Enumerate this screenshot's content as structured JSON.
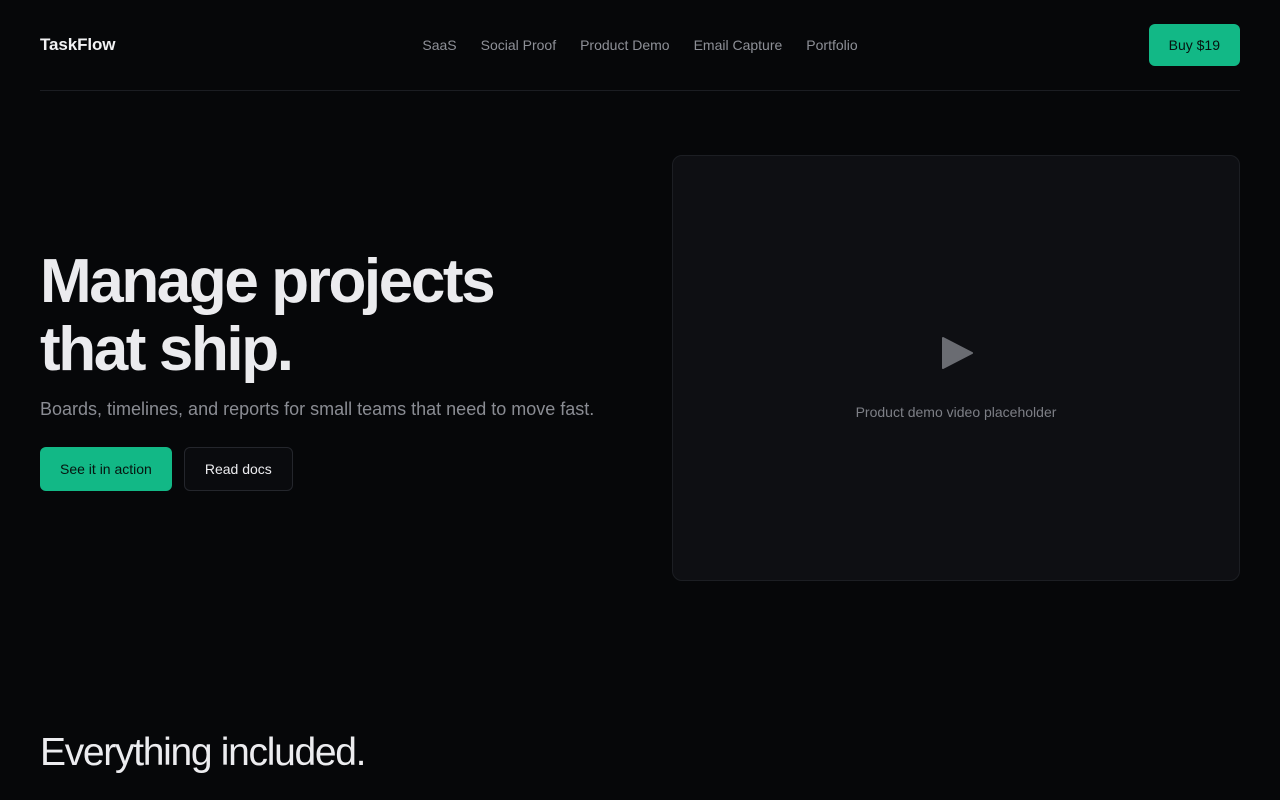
{
  "header": {
    "brand": "TaskFlow",
    "nav": [
      "SaaS",
      "Social Proof",
      "Product Demo",
      "Email Capture",
      "Portfolio"
    ],
    "buy_label": "Buy $19"
  },
  "hero": {
    "title_line1": "Manage projects",
    "title_line2": "that ship.",
    "subtitle": "Boards, timelines, and reports for small teams that need to move fast.",
    "primary_cta": "See it in action",
    "secondary_cta": "Read docs"
  },
  "video": {
    "icon": "play-icon",
    "caption": "Product demo video placeholder"
  },
  "features": {
    "title": "Everything included."
  },
  "colors": {
    "background": "#060709",
    "accent": "#12b886",
    "panel": "#0e0f13",
    "muted_text": "#8a8c93"
  }
}
